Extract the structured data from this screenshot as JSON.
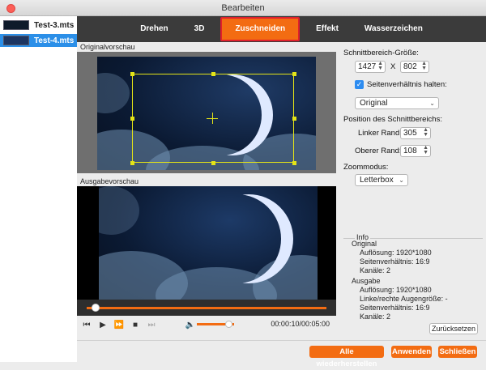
{
  "window": {
    "title": "Bearbeiten"
  },
  "sidebar": {
    "files": [
      {
        "name": "Test-3.mts",
        "selected": false
      },
      {
        "name": "Test-4.mts",
        "selected": true
      }
    ]
  },
  "tabs": [
    {
      "label": "Drehen"
    },
    {
      "label": "3D"
    },
    {
      "label": "Zuschneiden",
      "active": true
    },
    {
      "label": "Effekt"
    },
    {
      "label": "Wasserzeichen"
    }
  ],
  "preview": {
    "original_label": "Originalvorschau",
    "output_label": "Ausgabevorschau",
    "timecode": "00:00:10/00:05:00"
  },
  "crop": {
    "size_label": "Schnittbereich-Größe:",
    "width": "1427",
    "x_sep": "X",
    "height": "802",
    "keep_ratio_label": "Seitenverhältnis halten:",
    "ratio_value": "Original",
    "position_label": "Position des Schnittbereichs:",
    "left_label": "Linker Rand:",
    "left_value": "305",
    "top_label": "Oberer Rand:",
    "top_value": "108",
    "zoom_label": "Zoommodus:",
    "zoom_value": "Letterbox"
  },
  "info": {
    "header": "Info",
    "original_header": "Original",
    "orig_resolution": "Auflösung: 1920*1080",
    "orig_ratio": "Seitenverhältnis: 16:9",
    "orig_channels": "Kanäle: 2",
    "output_header": "Ausgabe",
    "out_resolution": "Auflösung: 1920*1080",
    "out_eye": "Linke/rechte Augengröße: -",
    "out_ratio": "Seitenverhältnis: 16:9",
    "out_channels": "Kanäle: 2"
  },
  "buttons": {
    "reset": "Zurücksetzen",
    "restore_all": "Alle wiederherstellen",
    "apply": "Anwenden",
    "close": "Schließen"
  },
  "playback": {
    "progress_fraction": 0.03,
    "volume_fraction": 0.85
  },
  "colors": {
    "accent": "#f36c12",
    "tabbar": "#3b3b3b",
    "selection": "#2b8fe8",
    "crop_frame": "#e4e417"
  }
}
